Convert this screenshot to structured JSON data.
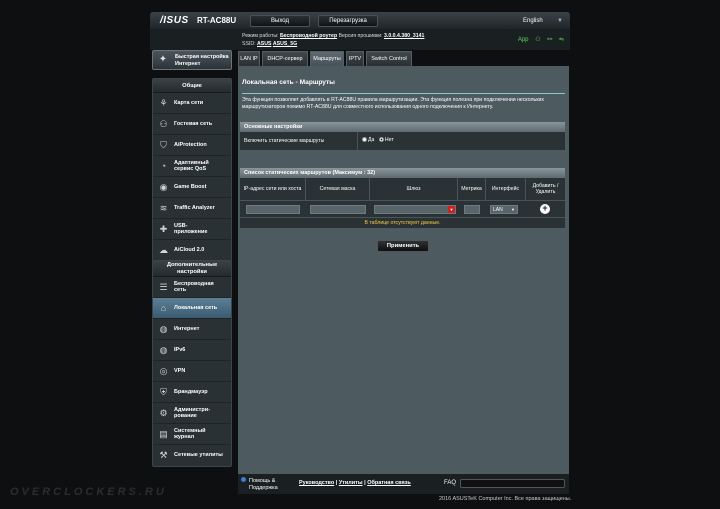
{
  "header": {
    "logo": "/ISUS",
    "model": "RT-AC88U",
    "logout": "Выход",
    "reboot": "Перезагрузка",
    "language": "English"
  },
  "status": {
    "mode_label": "Режим работы:",
    "mode_value": "Беспроводной роутер",
    "firmware_label": "Версия прошивки:",
    "firmware_value": "3.0.0.4.380_3141",
    "ssid_label": "SSID:",
    "ssid_1": "ASUS",
    "ssid_2": "ASUS_5G",
    "app_label": "App"
  },
  "sidebar": {
    "quick_setup": "Быстрая настройка Интернет",
    "general_header": "Общие",
    "general_items": [
      {
        "label": "Карта сети"
      },
      {
        "label": "Гостевая сеть"
      },
      {
        "label": "AiProtection"
      },
      {
        "label": "Адаптивный сервис QoS"
      },
      {
        "label": "Game Boost"
      },
      {
        "label": "Traffic Analyzer"
      },
      {
        "label": "USB-приложение"
      },
      {
        "label": "AiCloud 2.0"
      }
    ],
    "advanced_header": "Дополнительные настройки",
    "advanced_items": [
      {
        "label": "Беспроводная сеть"
      },
      {
        "label": "Локальная сеть"
      },
      {
        "label": "Интернет"
      },
      {
        "label": "IPv6"
      },
      {
        "label": "VPN"
      },
      {
        "label": "Брандмауэр"
      },
      {
        "label": "Администри-рование"
      },
      {
        "label": "Системный журнал"
      },
      {
        "label": "Сетевые утилиты"
      }
    ]
  },
  "tabs": [
    "LAN IP",
    "DHCP-сервер",
    "Маршруты",
    "IPTV",
    "Switch Control"
  ],
  "main": {
    "title": "Локальная сеть - Маршруты",
    "description": "Эта функция позволяет добавлять в RT-AC88U правила маршрутизации. Эта функция полезна при подключении нескольких маршрутизаторов помимо RT-AC88U для совместного использования одного подключения к Интернету.",
    "basic_header": "Основные настройки",
    "static_label": "Включить статические маршруты",
    "yes": "Да",
    "no": "Нет",
    "list_header": "Список статических маршрутов (Максимум : 32)",
    "columns": {
      "ip": "IP-адрес сети или хоста",
      "mask": "Сетевая маска",
      "gateway": "Шлюз",
      "metric": "Метрика",
      "iface": "Интерфейс",
      "add": "Добавить / Удалить"
    },
    "iface_value": "LAN",
    "empty": "В таблице отсутствуют данные.",
    "apply": "Применить"
  },
  "footer": {
    "help": "Помощь &",
    "support": "Поддержка",
    "manual": "Руководство",
    "utilities": "Утилиты",
    "feedback": "Обратная связь",
    "sep": " | ",
    "faq": "FAQ",
    "copyright": "2016 ASUSTeK Computer Inc. Все права защищены."
  },
  "watermark": "OVERCLOCKERS.RU"
}
